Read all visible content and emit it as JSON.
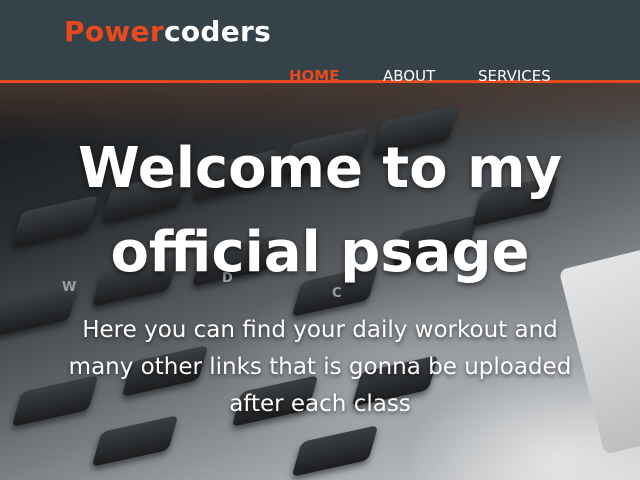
{
  "brand": {
    "highlight": "Power",
    "rest": "coders",
    "accent_color": "#e8491d",
    "header_color": "#35424a"
  },
  "nav": {
    "items": [
      {
        "label": "HOME",
        "active": true
      },
      {
        "label": "ABOUT",
        "active": false
      },
      {
        "label": "SERVICES",
        "active": false
      }
    ]
  },
  "showcase": {
    "title": "Welcome to my official psage",
    "text": "Here you can find your daily workout and many other links that is gonna be uploaded after each class",
    "key_labels": [
      "W",
      "D",
      "C"
    ]
  }
}
